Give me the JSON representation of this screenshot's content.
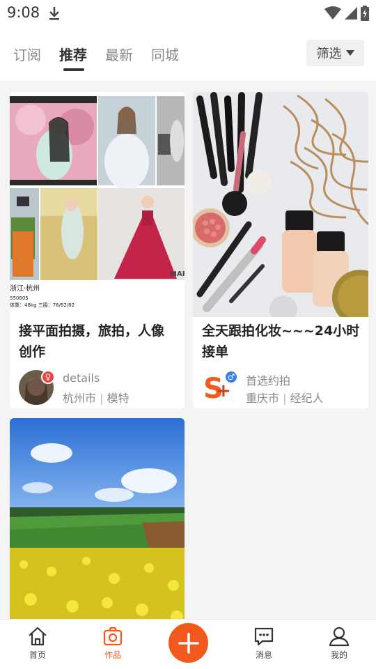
{
  "status_bar": {
    "time": "9:08"
  },
  "tabs": [
    {
      "label": "订阅"
    },
    {
      "label": "推荐"
    },
    {
      "label": "最新"
    },
    {
      "label": "同城"
    }
  ],
  "active_tab": "推荐",
  "filter": {
    "label": "筛选"
  },
  "cards": [
    {
      "title_line1": "接平面拍摄，旅拍，人像",
      "title_line2": "创作",
      "author": "details",
      "city": "杭州市",
      "role": "模特",
      "gender": "female",
      "image_caption_lines": [
        "浙江·杭州",
        "550605",
        "体重：48kg 三围：76/62/82"
      ],
      "image_brand": "MARI"
    },
    {
      "title_line1": "全天跟拍化妆~~~24小时",
      "title_line2": "接单",
      "author": "首选约拍",
      "city": "重庆市",
      "role": "经纪人",
      "gender": "male"
    },
    {
      "title_line1": "",
      "image": "landscape-field"
    }
  ],
  "separator": "|",
  "bottom_nav": [
    {
      "label": "首页",
      "icon": "home-icon"
    },
    {
      "label": "作品",
      "icon": "camera-icon"
    },
    {
      "label": "",
      "icon": "plus-icon"
    },
    {
      "label": "消息",
      "icon": "message-icon"
    },
    {
      "label": "我的",
      "icon": "user-icon"
    }
  ],
  "colors": {
    "accent": "#f25a1d",
    "female": "#f2403d",
    "male": "#3b7de9"
  }
}
